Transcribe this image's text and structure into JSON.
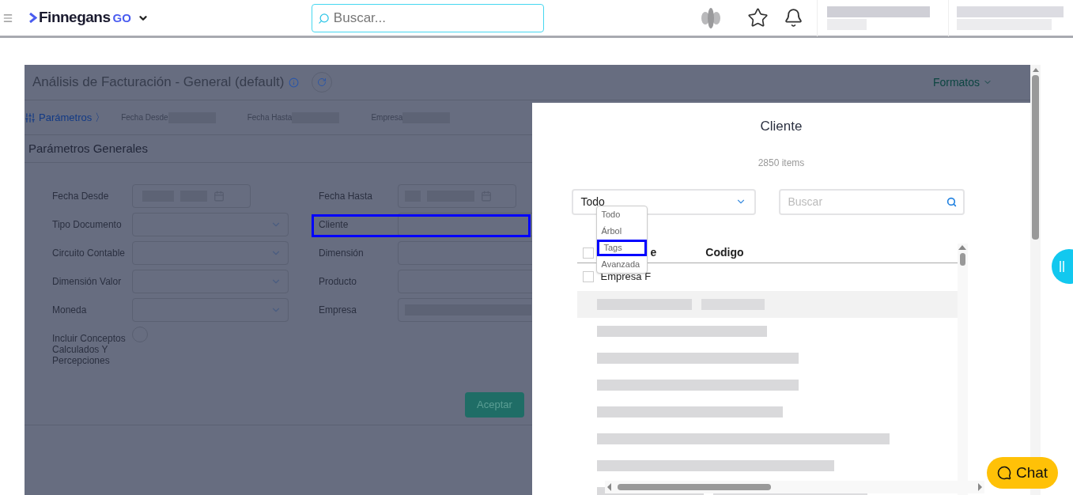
{
  "header": {
    "brand": "Finnegans",
    "brand_suffix": "GO",
    "search": {
      "placeholder": "Buscar..."
    }
  },
  "report": {
    "title": "Análisis de Facturación - General (default)",
    "formats": "Formatos",
    "breadcrumb": [
      {
        "label": "Parámetros",
        "selected": true
      },
      {
        "label": "Fecha Desde",
        "selected": false
      },
      {
        "label": "Fecha Hasta",
        "selected": false
      },
      {
        "label": "Empresa",
        "selected": false
      }
    ],
    "section": "Parámetros Generales",
    "left_fields": [
      {
        "label": "Fecha Desde",
        "kind": "date"
      },
      {
        "label": "Tipo Documento",
        "kind": "select"
      },
      {
        "label": "Circuito Contable",
        "kind": "select"
      },
      {
        "label": "Dimensión Valor",
        "kind": "select"
      },
      {
        "label": "Moneda",
        "kind": "select"
      },
      {
        "label": "Incluir Conceptos Calculados Y Percepciones",
        "kind": "radio",
        "checked": false
      }
    ],
    "separator": "〉",
    "right_fields": [
      {
        "label": "Fecha Hasta",
        "kind": "date",
        "highlighted": false
      },
      {
        "label": "Cliente",
        "kind": "text",
        "highlighted": true
      },
      {
        "label": "Dimensión",
        "kind": "text",
        "highlighted": false
      },
      {
        "label": "Producto",
        "kind": "text",
        "highlighted": false
      },
      {
        "label": "Empresa",
        "kind": "filled",
        "highlighted": false
      }
    ],
    "accept": "Aceptar"
  },
  "modal": {
    "title": "Cliente",
    "count": "2850 items",
    "mode": "Todo",
    "options": [
      {
        "label": "Todo",
        "highlighted": false
      },
      {
        "label": "Árbol",
        "highlighted": false
      },
      {
        "label": "Tags",
        "highlighted": true
      },
      {
        "label": "Avanzada",
        "highlighted": false
      }
    ],
    "search": {
      "placeholder": "Buscar"
    },
    "columns": [
      "e",
      "Codigo"
    ],
    "header_checked": false,
    "first_row": "Empresa F",
    "first_row_checked": false
  },
  "chat": "Chat"
}
